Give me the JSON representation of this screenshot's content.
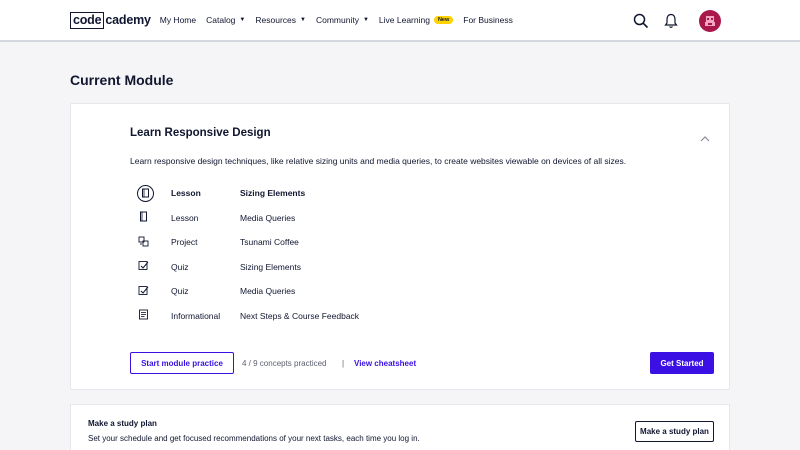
{
  "header": {
    "logo_left": "code",
    "logo_right": "cademy",
    "nav": [
      {
        "label": "My Home"
      },
      {
        "label": "Catalog"
      },
      {
        "label": "Resources"
      },
      {
        "label": "Community"
      },
      {
        "label": "Live Learning"
      },
      {
        "label": "For Business"
      }
    ],
    "new_badge": "New",
    "icons": [
      "search-icon",
      "bell-icon",
      "avatar"
    ]
  },
  "page_title": "Current Module",
  "module": {
    "title": "Learn Responsive Design",
    "description": "Learn responsive design techniques, like relative sizing units and media queries, to create websites viewable on devices of all sizes.",
    "items": [
      {
        "type": "Lesson",
        "name": "Sizing Elements",
        "icon": "lesson-icon",
        "current": true
      },
      {
        "type": "Lesson",
        "name": "Media Queries",
        "icon": "lesson-icon"
      },
      {
        "type": "Project",
        "name": "Tsunami Coffee",
        "icon": "project-icon"
      },
      {
        "type": "Quiz",
        "name": "Sizing Elements",
        "icon": "quiz-icon"
      },
      {
        "type": "Quiz",
        "name": "Media Queries",
        "icon": "quiz-icon"
      },
      {
        "type": "Informational",
        "name": "Next Steps & Course Feedback",
        "icon": "article-icon"
      }
    ],
    "practice_button": "Start module practice",
    "concepts": "4 / 9 concepts practiced",
    "separator": "|",
    "cheatsheet": "View cheatsheet",
    "start_button": "Get Started"
  },
  "study_plan": {
    "title": "Make a study plan",
    "description": "Set your schedule and get focused recommendations of your next tasks, each time you log in.",
    "button": "Make a study plan"
  },
  "colors": {
    "accent": "#3a10e5",
    "navy": "#10162f",
    "badge": "#ffd300",
    "avatar": "#a8184b"
  }
}
